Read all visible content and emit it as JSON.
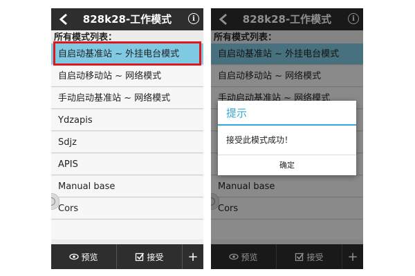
{
  "header": {
    "title": "828k28-工作模式",
    "info_label": "i"
  },
  "caption": "所有模式列表：",
  "modes": [
    "自启动基准站 ~ 外挂电台模式",
    "自启动移动站 ~ 网络模式",
    "手动启动基准站 ~ 网络模式",
    "Ydzapis",
    "Sdjz",
    "APIS",
    "Manual base",
    "Cors"
  ],
  "toolbar": {
    "preview_label": "预览",
    "accept_label": "接受",
    "add_label": "+"
  },
  "dialog": {
    "title": "提示",
    "message": "接受此模式成功！",
    "ok_label": "确定"
  },
  "colors": {
    "selected": "#7fc9e2",
    "highlight_box": "#e0161d",
    "dialog_accent": "#33a8d8",
    "bar": "#2e2e2e"
  }
}
